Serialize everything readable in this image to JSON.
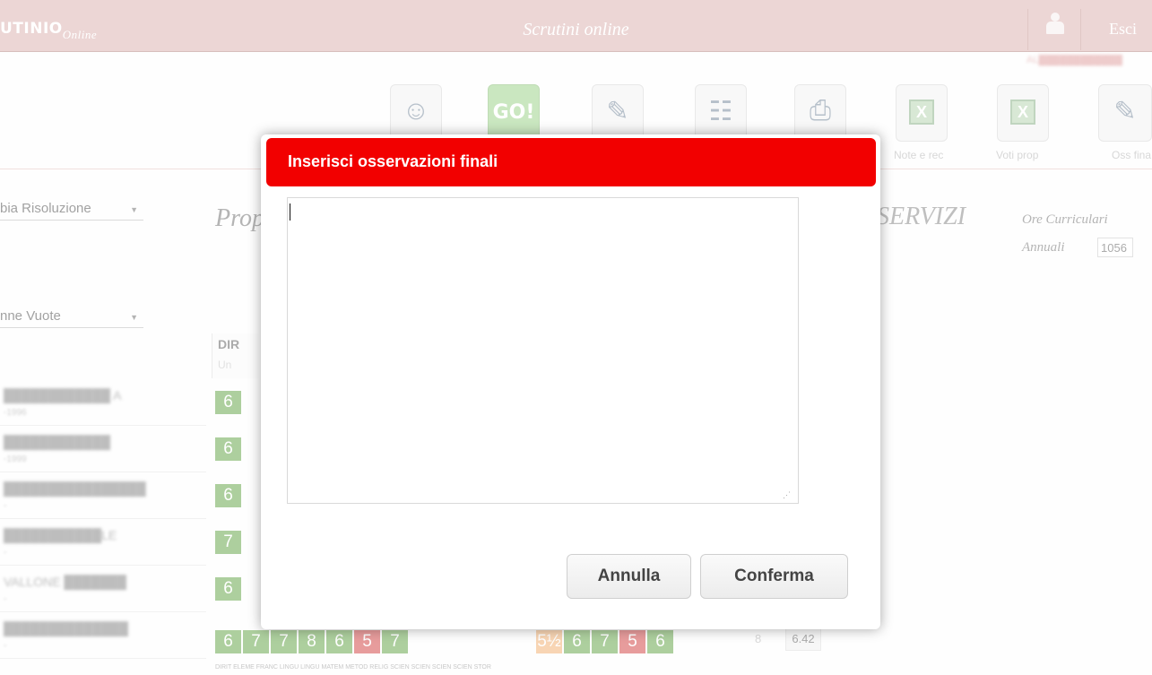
{
  "header": {
    "brand": "UTINIO",
    "brand_sub": "Online",
    "app_title": "Scrutini online",
    "exit_label": "Esci",
    "user_line": "AL████████████"
  },
  "toolbar": {
    "labels": [
      "Note e rec",
      "Voti prop",
      "Oss fina"
    ],
    "go_label": "GO!"
  },
  "filters": {
    "resolution_select": "bia Risoluzione",
    "columns_select": "nne Vuote"
  },
  "page": {
    "title_left": "Prop",
    "title_right": "SERVIZI",
    "ore_label": "Ore Curriculari",
    "annuali_label": "Annuali",
    "annuali_value": "1056"
  },
  "grid": {
    "col_header": "DIR",
    "col_sub": "Un",
    "students": [
      {
        "name": "████████████ A",
        "date": "-1996"
      },
      {
        "name": "████████████",
        "date": "-1999"
      },
      {
        "name": "████████████████",
        "date": "-"
      },
      {
        "name": "███████████LE",
        "date": "-"
      },
      {
        "name": "VALLONE ███████",
        "date": "-"
      },
      {
        "name": "██████████████",
        "date": "-"
      }
    ],
    "first_col_grades": [
      "6",
      "6",
      "6",
      "7",
      "6"
    ],
    "last_row_grades": [
      "6",
      "7",
      "7",
      "8",
      "6",
      "5",
      "7",
      "5½",
      "6",
      "7",
      "5",
      "6"
    ],
    "last_row_eight": "8",
    "last_row_average": "6.42",
    "subjects_row": "DIRIT  ELEME  FRANC  LINGU  LINGU  MATEM  METOD  RELIG  SCIEN  SCIEN  SCIEN  SCIEN  STOR"
  },
  "modal": {
    "title": "Inserisci osservazioni finali",
    "textarea_value": "",
    "cancel_label": "Annulla",
    "confirm_label": "Conferma"
  }
}
